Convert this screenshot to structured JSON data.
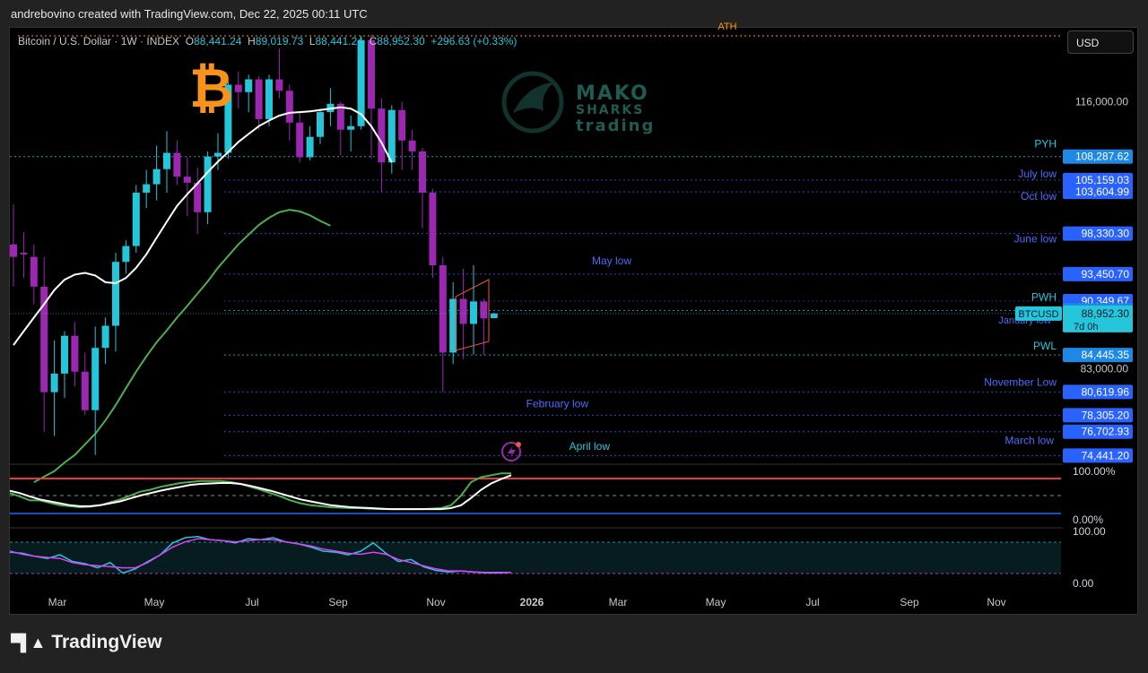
{
  "header": {
    "credit": "andrebovino created with TradingView.com, Dec 22, 2025 00:11 UTC"
  },
  "legend": {
    "symbol": "Bitcoin / U.S. Dollar · 1W · INDEX",
    "open_label": "O",
    "open": "88,441.24",
    "high_label": "H",
    "high": "89,019.73",
    "low_label": "L",
    "low": "88,441.24",
    "close_label": "C",
    "close": "88,952.30",
    "change": "+296.63 (+0.33%)"
  },
  "currency_button": "USD",
  "logo": {
    "line1": "MAKO",
    "line2": "SHARKS",
    "line3": "trading"
  },
  "footer": {
    "brand": "TradingView",
    "logo_icon": "tradingview-logo-icon"
  },
  "ath_label": "ATH",
  "chart_data": [
    {
      "type": "candlestick",
      "title": "Bitcoin / U.S. Dollar · 1W · INDEX",
      "scale": "log",
      "y_ticks": [
        116000,
        83000
      ],
      "y_tick_labels": [
        "116,000.00",
        "83,000.00"
      ],
      "x_ticks": [
        "Mar",
        "May",
        "Jul",
        "Sep",
        "Nov",
        "2026",
        "Mar",
        "May",
        "Jul",
        "Sep",
        "Nov"
      ],
      "candles": [
        {
          "o": 97000,
          "h": 102000,
          "l": 92000,
          "c": 95500
        },
        {
          "o": 96000,
          "h": 98500,
          "l": 93000,
          "c": 95800
        },
        {
          "o": 95500,
          "h": 97000,
          "l": 90000,
          "c": 92000
        },
        {
          "o": 92000,
          "h": 95500,
          "l": 76700,
          "c": 80600
        },
        {
          "o": 80600,
          "h": 86000,
          "l": 76300,
          "c": 82500
        },
        {
          "o": 82500,
          "h": 87000,
          "l": 80000,
          "c": 86500
        },
        {
          "o": 86500,
          "h": 88000,
          "l": 81200,
          "c": 82700
        },
        {
          "o": 82700,
          "h": 84700,
          "l": 78300,
          "c": 78800
        },
        {
          "o": 78800,
          "h": 87500,
          "l": 74500,
          "c": 85200
        },
        {
          "o": 85200,
          "h": 88500,
          "l": 83500,
          "c": 87600
        },
        {
          "o": 87600,
          "h": 96000,
          "l": 84800,
          "c": 94900
        },
        {
          "o": 94900,
          "h": 97500,
          "l": 93500,
          "c": 96800
        },
        {
          "o": 96800,
          "h": 104500,
          "l": 96000,
          "c": 103500
        },
        {
          "o": 103500,
          "h": 106500,
          "l": 101500,
          "c": 104600
        },
        {
          "o": 104600,
          "h": 109800,
          "l": 102500,
          "c": 106600
        },
        {
          "o": 106600,
          "h": 111800,
          "l": 103500,
          "c": 108800
        },
        {
          "o": 108800,
          "h": 110500,
          "l": 104500,
          "c": 105600
        },
        {
          "o": 105600,
          "h": 108200,
          "l": 100500,
          "c": 104800
        },
        {
          "o": 104800,
          "h": 106800,
          "l": 98300,
          "c": 101000
        },
        {
          "o": 101000,
          "h": 109000,
          "l": 99500,
          "c": 108300
        },
        {
          "o": 108300,
          "h": 111500,
          "l": 106500,
          "c": 108800
        },
        {
          "o": 108800,
          "h": 119000,
          "l": 108000,
          "c": 118500
        },
        {
          "o": 118500,
          "h": 120500,
          "l": 115000,
          "c": 117400
        },
        {
          "o": 117400,
          "h": 120000,
          "l": 114500,
          "c": 119300
        },
        {
          "o": 119300,
          "h": 119800,
          "l": 112000,
          "c": 113500
        },
        {
          "o": 113500,
          "h": 120000,
          "l": 112500,
          "c": 119300
        },
        {
          "o": 119300,
          "h": 124000,
          "l": 116500,
          "c": 117600
        },
        {
          "o": 117600,
          "h": 118500,
          "l": 110500,
          "c": 113000
        },
        {
          "o": 113000,
          "h": 114500,
          "l": 107500,
          "c": 108200
        },
        {
          "o": 108200,
          "h": 112500,
          "l": 107800,
          "c": 111000
        },
        {
          "o": 111000,
          "h": 115000,
          "l": 110000,
          "c": 114500
        },
        {
          "o": 114500,
          "h": 118000,
          "l": 112500,
          "c": 115700
        },
        {
          "o": 115700,
          "h": 116000,
          "l": 108500,
          "c": 112000
        },
        {
          "o": 112000,
          "h": 114000,
          "l": 109000,
          "c": 112500
        },
        {
          "o": 112500,
          "h": 126000,
          "l": 112000,
          "c": 125300
        },
        {
          "o": 125300,
          "h": 126200,
          "l": 108000,
          "c": 115000
        },
        {
          "o": 115000,
          "h": 116500,
          "l": 103600,
          "c": 107500
        },
        {
          "o": 107500,
          "h": 115500,
          "l": 106000,
          "c": 114800
        },
        {
          "o": 114800,
          "h": 116000,
          "l": 106500,
          "c": 110500
        },
        {
          "o": 110500,
          "h": 112000,
          "l": 106500,
          "c": 109000
        },
        {
          "o": 109000,
          "h": 109500,
          "l": 99000,
          "c": 103500
        },
        {
          "o": 103500,
          "h": 104000,
          "l": 93000,
          "c": 94500
        },
        {
          "o": 94500,
          "h": 95500,
          "l": 80600,
          "c": 84700
        },
        {
          "o": 84700,
          "h": 92500,
          "l": 83500,
          "c": 90600
        },
        {
          "o": 90600,
          "h": 94100,
          "l": 84000,
          "c": 87800
        },
        {
          "o": 87800,
          "h": 94500,
          "l": 84500,
          "c": 90300
        },
        {
          "o": 90300,
          "h": 90600,
          "l": 84450,
          "c": 88400
        },
        {
          "o": 88441.24,
          "h": 89019.73,
          "l": 88441.24,
          "c": 88952.3
        }
      ],
      "ma_white": [
        85500,
        87000,
        88500,
        90000,
        91600,
        92800,
        93400,
        93600,
        93300,
        92500,
        92400,
        93000,
        94200,
        95800,
        97800,
        99800,
        101800,
        103300,
        104700,
        106200,
        107600,
        108900,
        110300,
        111400,
        112500,
        113300,
        114000,
        114400,
        114500,
        114600,
        114800,
        115000,
        115200,
        115000,
        114200,
        112500,
        110200,
        107500
      ],
      "ma_white_start": 0,
      "ma_green": [
        72000,
        72500,
        73000,
        73800,
        74500,
        75500,
        76500,
        77800,
        79300,
        81000,
        82700,
        84300,
        85800,
        87100,
        88500,
        89800,
        91200,
        92600,
        94200,
        95600,
        97000,
        98200,
        99400,
        100300,
        101000,
        101300,
        101100,
        100600,
        99900,
        99300
      ],
      "ma_green_start": 2,
      "levels": [
        {
          "name": "PYH",
          "value": 108287.62,
          "label": "108,287.62",
          "color": "#26c6da"
        },
        {
          "name": "July low",
          "value": 105159.03,
          "label": "105,159.03",
          "color": "#3d5afe"
        },
        {
          "name": "Oct low",
          "value": 103604.99,
          "label": "103,604.99",
          "color": "#3d5afe"
        },
        {
          "name": "June low",
          "value": 98330.3,
          "label": "98,330.30",
          "color": "#3d5afe"
        },
        {
          "name": "May low",
          "value": 93450.7,
          "label": "93,450.70",
          "color": "#3d5afe"
        },
        {
          "name": "",
          "value": 90349.67,
          "label": "90,349.67",
          "color": "#2c3e9a"
        },
        {
          "name": "PWH",
          "value": 89298.61,
          "label": "89,298.61",
          "color": "#26c6da"
        },
        {
          "name": "PWL",
          "value": 84445.35,
          "label": "84,445.35",
          "color": "#26c6da"
        },
        {
          "name": "November Low",
          "value": 80619.96,
          "label": "80,619.96",
          "color": "#3d5afe"
        },
        {
          "name": "February low",
          "value": 78305.2,
          "label": "78,305.20",
          "color": "#3d5afe"
        },
        {
          "name": "",
          "value": 76702.93,
          "label": "76,702.93",
          "color": "#3d5afe"
        },
        {
          "name": "March low",
          "value": 74441.2,
          "label": "74,441.20",
          "color": "#3d5afe"
        }
      ],
      "extra_labels": [
        "April low",
        "January low"
      ],
      "current_price": {
        "symbol": "BTCUSD",
        "value": "88,952.30",
        "countdown": "7d 0h"
      },
      "colors": {
        "up": "#26c6da",
        "down": "#9c27b0",
        "ma_white": "#ffffff",
        "ma_green": "#4caf50",
        "level": "#3d5afe",
        "key_level": "#26c6da",
        "ath": "#ff9800"
      }
    },
    {
      "type": "line",
      "name": "oscillator-1",
      "ylim": [
        0,
        100
      ],
      "tick_labels": [
        "100.00%",
        "0.00%"
      ],
      "series": [
        {
          "color": "#4caf50",
          "values": [
            55,
            48,
            40,
            40,
            35,
            30,
            28,
            26,
            27,
            30,
            36,
            42,
            50,
            58,
            62,
            68,
            72,
            76,
            78,
            80,
            80,
            80,
            78,
            74,
            68,
            62,
            55,
            48,
            40,
            34,
            30,
            28,
            26,
            25,
            24,
            24,
            23,
            22,
            22,
            22,
            22,
            22,
            23,
            24,
            30,
            50,
            78,
            88,
            92,
            96,
            96
          ]
        },
        {
          "color": "#ffffff",
          "values": [
            60,
            55,
            48,
            42,
            38,
            34,
            30,
            28,
            28,
            30,
            34,
            38,
            44,
            50,
            55,
            60,
            64,
            68,
            72,
            74,
            75,
            76,
            76,
            74,
            70,
            65,
            60,
            54,
            48,
            42,
            38,
            34,
            30,
            28,
            26,
            25,
            24,
            23,
            22,
            22,
            22,
            22,
            22,
            22,
            24,
            30,
            45,
            62,
            75,
            84,
            92
          ]
        }
      ]
    },
    {
      "type": "line",
      "name": "oscillator-2",
      "ylim": [
        0,
        100
      ],
      "tick_labels": [
        "100.00",
        "0.00"
      ],
      "series": [
        {
          "color": "#26c6da",
          "values": [
            60,
            58,
            52,
            48,
            55,
            42,
            38,
            30,
            40,
            20,
            28,
            42,
            55,
            78,
            88,
            90,
            84,
            82,
            78,
            86,
            84,
            88,
            80,
            76,
            70,
            62,
            60,
            55,
            62,
            78,
            58,
            42,
            46,
            32,
            25,
            22,
            24,
            22,
            20,
            20,
            21
          ]
        },
        {
          "color": "#e040fb",
          "values": [
            62,
            56,
            52,
            50,
            48,
            40,
            36,
            34,
            32,
            30,
            30,
            40,
            55,
            70,
            80,
            86,
            84,
            82,
            80,
            82,
            84,
            84,
            80,
            76,
            72,
            66,
            62,
            58,
            56,
            60,
            56,
            46,
            40,
            34,
            28,
            24,
            24,
            22,
            21,
            21,
            21
          ]
        }
      ]
    }
  ]
}
